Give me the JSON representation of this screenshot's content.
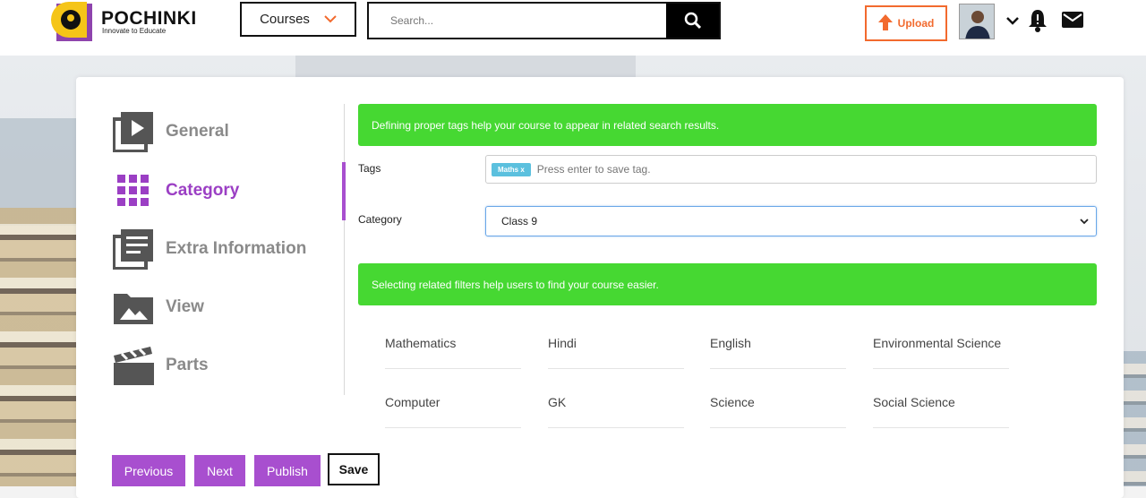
{
  "brand": {
    "name": "POCHINKI",
    "tagline": "Innovate to Educate"
  },
  "header": {
    "courses_label": "Courses",
    "search_placeholder": "Search...",
    "upload_label": "Upload"
  },
  "sidebar": {
    "items": [
      {
        "label": "General",
        "icon": "video-library-icon"
      },
      {
        "label": "Category",
        "icon": "grid-icon",
        "active": true
      },
      {
        "label": "Extra Information",
        "icon": "document-library-icon"
      },
      {
        "label": "View",
        "icon": "image-folder-icon"
      },
      {
        "label": "Parts",
        "icon": "clapperboard-icon"
      }
    ]
  },
  "main": {
    "tags_alert": "Defining proper tags help your course to appear in related search results.",
    "tags_label": "Tags",
    "tag_chip": "Maths x",
    "tags_placeholder": "Press enter to save tag.",
    "category_label": "Category",
    "category_value": "Class 9",
    "filters_alert": "Selecting related filters help users to find your course easier.",
    "filters": [
      "Mathematics",
      "Hindi",
      "English",
      "Environmental Science",
      "Computer",
      "GK",
      "Science",
      "Social Science"
    ]
  },
  "actions": {
    "previous": "Previous",
    "next": "Next",
    "publish": "Publish",
    "save": "Save"
  },
  "colors": {
    "accent": "#a84fcf",
    "upload": "#f26a2e",
    "alert": "#46d832",
    "logo_yellow": "#f5c518"
  }
}
